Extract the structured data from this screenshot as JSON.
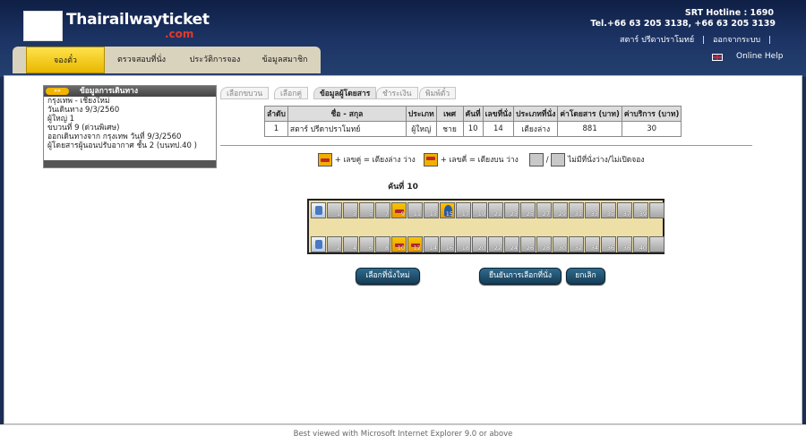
{
  "header": {
    "logo_text": "Thairailwayticket",
    "logo_domain": ".com",
    "hotline": "SRT Hotline : 1690",
    "tel": "Tel.+66 63 205 3138, +66 63 205 3139",
    "user_name": "สตาร์ ปรีดาปราโมทย์",
    "separator": "|",
    "logout": "ออกจากระบบ",
    "separator2": "|",
    "online_help": "Online Help"
  },
  "nav": {
    "tabs": [
      "จองตั๋ว",
      "ตรวจสอบที่นั่ง",
      "ประวัติการจอง",
      "ข้อมูลสมาชิก"
    ]
  },
  "trip_panel": {
    "title": "ข้อมูลการเดินทาง",
    "arrow": "»»",
    "lines": [
      "กรุงเทพ - เชียงใหม่",
      "วันเดินทาง 9/3/2560",
      "ผู้ใหญ่ 1",
      "ขบวนที่ 9 (ด่วนพิเศษ)",
      "ออกเดินทางจาก กรุงเทพ วันที่ 9/3/2560",
      "ผู้โดยสารผู้นอนปรับอากาศ ชั้น 2 (บนทป.40 )"
    ]
  },
  "steps": [
    "เลือกขบวน",
    "เลือกคู่",
    "ข้อมูลผู้โดยสาร",
    "ชำระเงิน",
    "พิมพ์ตั๋ว"
  ],
  "passenger_table": {
    "headers": [
      "ลำดับ",
      "ชื่อ - สกุล",
      "ประเภท",
      "เพศ",
      "คันที่",
      "เลขที่นั่ง",
      "ประเภทที่นั่ง",
      "ค่าโดยสาร (บาท)",
      "ค่าบริการ (บาท)"
    ],
    "rows": [
      [
        "1",
        "สตาร์ ปรีดาปราโมทย์",
        "ผู้ใหญ่",
        "ชาย",
        "10",
        "14",
        "เตียงล่าง",
        "881",
        "30"
      ]
    ]
  },
  "legend": {
    "lower": "+ เลขคู่ = เตียงล่าง ว่าง",
    "upper": "+ เลขคี่ = เตียงบน ว่าง",
    "slash": "/",
    "unavailable": "ไม่มีที่นั่งว่าง/ไม่เปิดจอง"
  },
  "coach": {
    "label": "คันที่ 10",
    "top_row": [
      {
        "type": "wc",
        "num": ""
      },
      {
        "type": "seat",
        "num": "1"
      },
      {
        "type": "seat",
        "num": "3"
      },
      {
        "type": "seat",
        "num": "5"
      },
      {
        "type": "seat",
        "num": "7"
      },
      {
        "type": "occupied",
        "num": "9"
      },
      {
        "type": "seat",
        "num": "11"
      },
      {
        "type": "seat",
        "num": "13"
      },
      {
        "type": "selected",
        "num": "15"
      },
      {
        "type": "seat",
        "num": "17"
      },
      {
        "type": "seat",
        "num": "19"
      },
      {
        "type": "seat",
        "num": "21"
      },
      {
        "type": "seat",
        "num": "23"
      },
      {
        "type": "seat",
        "num": "25"
      },
      {
        "type": "seat",
        "num": "27"
      },
      {
        "type": "seat",
        "num": "29"
      },
      {
        "type": "seat",
        "num": "31"
      },
      {
        "type": "seat",
        "num": "33"
      },
      {
        "type": "seat",
        "num": "35"
      },
      {
        "type": "seat",
        "num": "37"
      },
      {
        "type": "seat",
        "num": "39"
      },
      {
        "type": "seat",
        "num": ""
      }
    ],
    "bottom_row": [
      {
        "type": "wc",
        "num": ""
      },
      {
        "type": "seat",
        "num": "2"
      },
      {
        "type": "seat",
        "num": "4"
      },
      {
        "type": "seat",
        "num": "6"
      },
      {
        "type": "seat",
        "num": "8"
      },
      {
        "type": "occupied",
        "num": "10"
      },
      {
        "type": "occupied",
        "num": "12"
      },
      {
        "type": "seat",
        "num": "14"
      },
      {
        "type": "seat",
        "num": "16"
      },
      {
        "type": "seat",
        "num": "18"
      },
      {
        "type": "seat",
        "num": "20"
      },
      {
        "type": "seat",
        "num": "22"
      },
      {
        "type": "seat",
        "num": "24"
      },
      {
        "type": "seat",
        "num": "26"
      },
      {
        "type": "seat",
        "num": "28"
      },
      {
        "type": "seat",
        "num": "30"
      },
      {
        "type": "seat",
        "num": "32"
      },
      {
        "type": "seat",
        "num": "34"
      },
      {
        "type": "seat",
        "num": "36"
      },
      {
        "type": "seat",
        "num": "38"
      },
      {
        "type": "seat",
        "num": "40"
      },
      {
        "type": "seat",
        "num": ""
      }
    ]
  },
  "buttons": {
    "reselect": "เลือกที่นั่งใหม่",
    "confirm": "ยืนยันการเลือกที่นั่ง",
    "cancel": "ยกเลิก"
  },
  "footer": "Best viewed with Microsoft Internet Explorer 9.0 or above",
  "colors": {
    "header_bg": "#1d3566",
    "active_tab": "#f5d000",
    "coach_bg": "#eedfa6",
    "button_bg": "#1f5272",
    "logo_accent": "#e03a2c"
  }
}
